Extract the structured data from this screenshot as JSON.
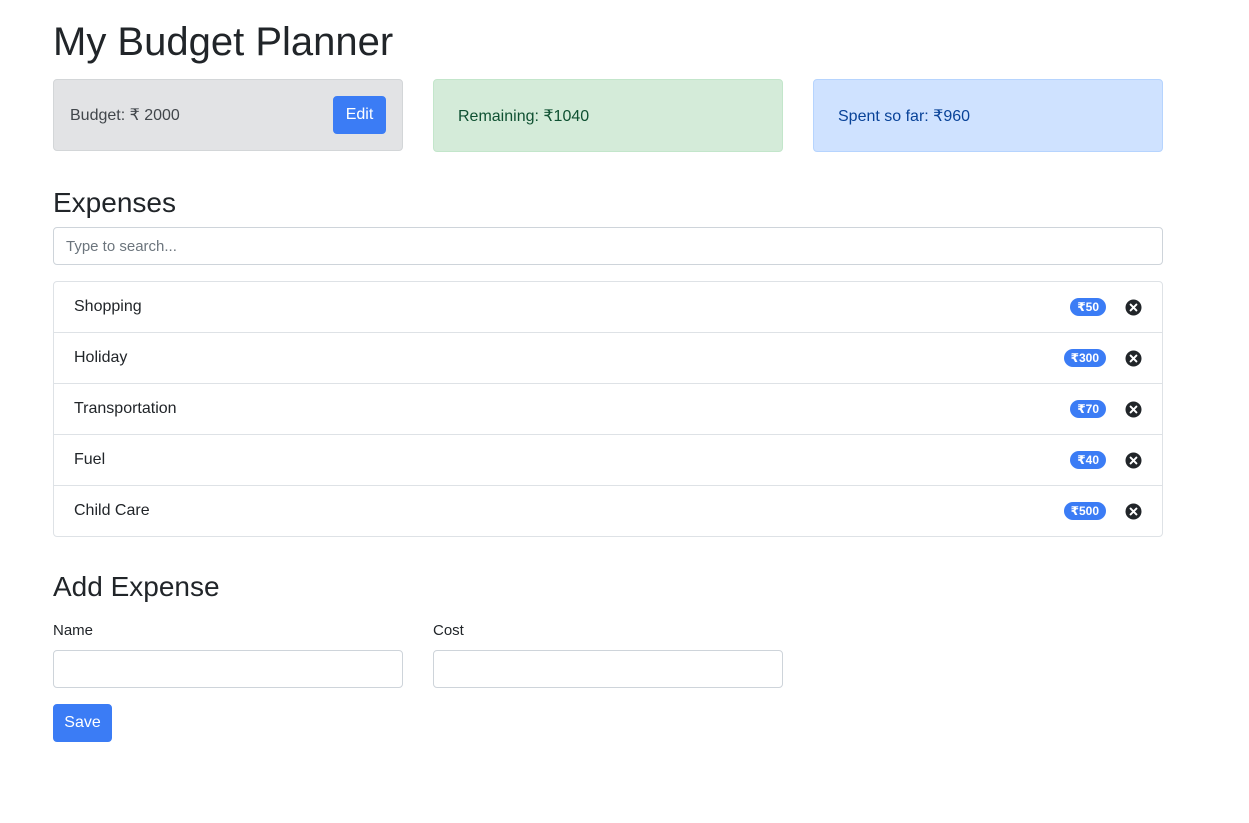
{
  "app": {
    "title": "My Budget Planner"
  },
  "summary": {
    "budget_text": "Budget: ₹ 2000",
    "edit_label": "Edit",
    "remaining_text": "Remaining: ₹1040",
    "spent_text": "Spent so far: ₹960"
  },
  "expenses": {
    "title": "Expenses",
    "search_placeholder": "Type to search...",
    "items": [
      {
        "name": "Shopping",
        "cost": "₹50"
      },
      {
        "name": "Holiday",
        "cost": "₹300"
      },
      {
        "name": "Transportation",
        "cost": "₹70"
      },
      {
        "name": "Fuel",
        "cost": "₹40"
      },
      {
        "name": "Child Care",
        "cost": "₹500"
      }
    ]
  },
  "add_expense": {
    "title": "Add Expense",
    "name_label": "Name",
    "cost_label": "Cost",
    "name_value": "",
    "cost_value": "",
    "save_label": "Save"
  },
  "colors": {
    "primary": "#3b7cf5",
    "budget_bg": "#e2e3e5",
    "remaining_bg": "#d4ebd9",
    "spent_bg": "#cfe2ff"
  },
  "icons": {
    "delete": "close-circle-icon"
  }
}
